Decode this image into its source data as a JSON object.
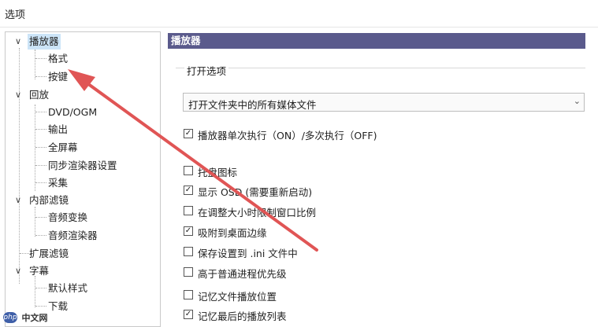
{
  "window": {
    "title": "选项"
  },
  "tree": {
    "nodes": [
      {
        "label": "播放器",
        "level": 0,
        "expanded": true,
        "selected": true
      },
      {
        "label": "格式",
        "level": 1
      },
      {
        "label": "按键",
        "level": 1
      },
      {
        "label": "回放",
        "level": 0,
        "expanded": true
      },
      {
        "label": "DVD/OGM",
        "level": 1
      },
      {
        "label": "输出",
        "level": 1
      },
      {
        "label": "全屏幕",
        "level": 1
      },
      {
        "label": "同步渲染器设置",
        "level": 1
      },
      {
        "label": "采集",
        "level": 1
      },
      {
        "label": "内部滤镜",
        "level": 0,
        "expanded": true
      },
      {
        "label": "音频变换",
        "level": 1
      },
      {
        "label": "音频渲染器",
        "level": 1
      },
      {
        "label": "扩展滤镜",
        "level": 0
      },
      {
        "label": "字幕",
        "level": 0,
        "expanded": true
      },
      {
        "label": "默认样式",
        "level": 1
      },
      {
        "label": "下载",
        "level": 1
      }
    ],
    "expanders": {
      "expanded": "∨"
    }
  },
  "panel": {
    "header": "播放器",
    "group_title": "打开选项",
    "combo": {
      "value": "打开文件夹中的所有媒体文件",
      "arrow": "⌄"
    },
    "checkboxes": [
      {
        "label": "播放器单次执行（ON）/多次执行（OFF)",
        "checked": true
      },
      {
        "label": "托盘图标",
        "checked": false
      },
      {
        "label": "显示 OSD (需要重新启动)",
        "checked": true
      },
      {
        "label": "在调整大小时限制窗口比例",
        "checked": false
      },
      {
        "label": "吸附到桌面边缘",
        "checked": true
      },
      {
        "label": "保存设置到 .ini 文件中",
        "checked": false
      },
      {
        "label": "高于普通进程优先级",
        "checked": false
      },
      {
        "label": "记忆文件播放位置",
        "checked": false
      },
      {
        "label": "记忆最后的播放列表",
        "checked": true
      }
    ],
    "check_glyph": "✓"
  },
  "annotation": {
    "color": "#e05555",
    "icon": "arrow-annotation"
  },
  "watermark": {
    "logo": "php",
    "text": "中文网"
  }
}
